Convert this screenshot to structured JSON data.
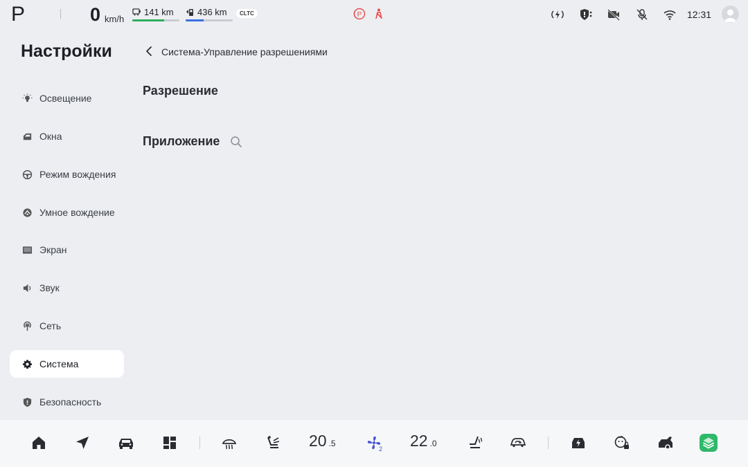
{
  "status": {
    "gear": "P",
    "speed_value": "0",
    "speed_unit": "km/h",
    "range_ev": "141 km",
    "range_ev_pct": 0.68,
    "range_total": "436 km",
    "range_total_pct": 0.38,
    "range_standard": "CLTC",
    "clock": "12:31",
    "colors": {
      "ev_bar": "#2fae5b",
      "total_bar": "#3a6fe0",
      "alert": "#e84a4a"
    }
  },
  "sidebar": {
    "title": "Настройки",
    "items": [
      {
        "label": "Освещение",
        "icon": "light-icon"
      },
      {
        "label": "Окна",
        "icon": "window-icon"
      },
      {
        "label": "Режим вождения",
        "icon": "steering-wheel-icon"
      },
      {
        "label": "Умное вождение",
        "icon": "smart-driving-icon"
      },
      {
        "label": "Экран",
        "icon": "screen-icon"
      },
      {
        "label": "Звук",
        "icon": "speaker-icon"
      },
      {
        "label": "Сеть",
        "icon": "network-icon"
      },
      {
        "label": "Система",
        "icon": "gear-icon",
        "active": true
      },
      {
        "label": "Безопасность",
        "icon": "shield-icon"
      }
    ]
  },
  "main": {
    "breadcrumb": "Система-Управление разрешениями",
    "section_permission": "Разрешение",
    "section_application": "Приложение"
  },
  "dock": {
    "driver_temp_int": "20",
    "driver_temp_dec": ".5",
    "passenger_temp_int": "22",
    "passenger_temp_dec": ".0",
    "fan_level": "2",
    "colors": {
      "fan": "#4a55d4",
      "app_green": "#2fb86a"
    }
  }
}
